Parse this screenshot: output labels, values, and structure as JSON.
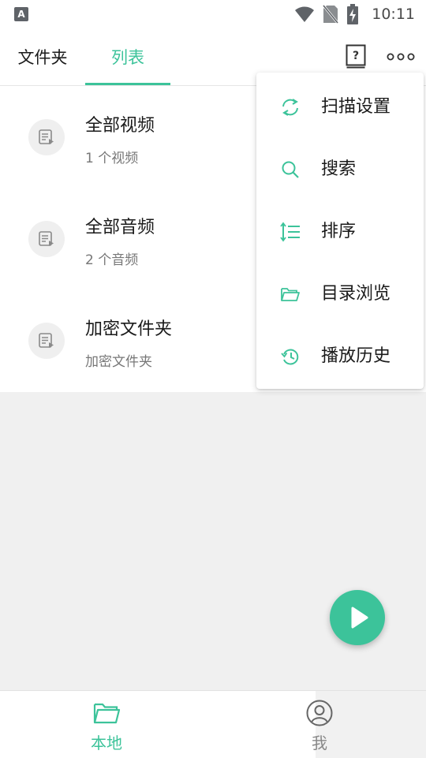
{
  "status_bar": {
    "left_icon_letter": "A",
    "icons": [
      "wifi-icon",
      "no-sim-icon",
      "battery-charging-icon"
    ],
    "time": "10:11"
  },
  "header": {
    "tabs": [
      {
        "label": "文件夹",
        "active": false
      },
      {
        "label": "列表",
        "active": true
      }
    ],
    "help_icon": "help-book-icon",
    "more_icon": "more-dots-icon"
  },
  "list": {
    "items": [
      {
        "title": "全部视频",
        "subtitle": "1 个视频",
        "icon": "playlist-icon"
      },
      {
        "title": "全部音频",
        "subtitle": "2 个音频",
        "icon": "playlist-icon"
      },
      {
        "title": "加密文件夹",
        "subtitle": "加密文件夹",
        "icon": "playlist-icon"
      }
    ]
  },
  "menu": {
    "items": [
      {
        "label": "扫描设置",
        "icon": "scan-refresh-icon"
      },
      {
        "label": "搜索",
        "icon": "search-icon"
      },
      {
        "label": "排序",
        "icon": "sort-icon"
      },
      {
        "label": "目录浏览",
        "icon": "folder-open-icon"
      },
      {
        "label": "播放历史",
        "icon": "history-icon"
      }
    ]
  },
  "fab": {
    "icon": "play-icon"
  },
  "bottom_nav": {
    "items": [
      {
        "label": "本地",
        "icon": "folder-icon",
        "active": true
      },
      {
        "label": "我",
        "icon": "user-icon",
        "active": false
      }
    ]
  },
  "colors": {
    "accent": "#3cc39a",
    "text": "#1a1a1a",
    "secondary_text": "#777777",
    "background": "#f0f0f0"
  }
}
